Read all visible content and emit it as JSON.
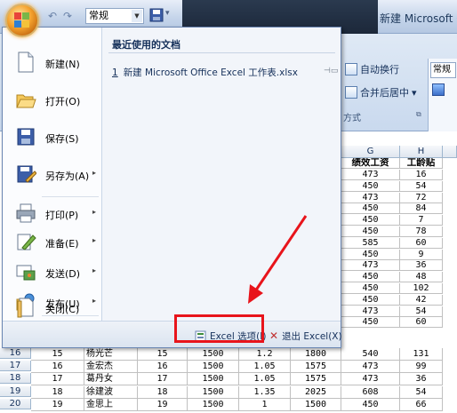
{
  "titlebar": {
    "style_combo": "常规",
    "app_title": "新建 Microsoft Of"
  },
  "ribbon": {
    "wrap_text": "自动换行",
    "merge_center": "合并后居中",
    "merge_arrow": "▾",
    "format_label": "常规",
    "group_alignment": "方式"
  },
  "columns": [
    {
      "letter": "G"
    },
    {
      "letter": "H"
    }
  ],
  "menu": {
    "items": [
      {
        "label": "新建(N)",
        "has_arrow": false
      },
      {
        "label": "打开(O)",
        "has_arrow": false
      },
      {
        "label": "保存(S)",
        "has_arrow": false
      },
      {
        "label": "另存为(A)",
        "has_arrow": true
      },
      {
        "label": "打印(P)",
        "has_arrow": true
      },
      {
        "label": "准备(E)",
        "has_arrow": true
      },
      {
        "label": "发送(D)",
        "has_arrow": true
      },
      {
        "label": "发布(U)",
        "has_arrow": true
      },
      {
        "label": "关闭(C)",
        "has_arrow": false
      }
    ],
    "arrow_glyph": "▸",
    "recent_header": "最近使用的文档",
    "recent_items": [
      {
        "number": "1",
        "name": "新建 Microsoft Office Excel 工作表.xlsx"
      }
    ],
    "excel_options": "Excel 选项(I)",
    "exit_excel": "退出 Excel(X)"
  },
  "visible_columns_right": {
    "header_G": "绩效工资",
    "header_H": "工龄贴",
    "rows": [
      [
        "473",
        "16"
      ],
      [
        "450",
        "54"
      ],
      [
        "473",
        "72"
      ],
      [
        "450",
        "84"
      ],
      [
        "450",
        "7"
      ],
      [
        "450",
        "78"
      ],
      [
        "585",
        "60"
      ],
      [
        "450",
        "9"
      ],
      [
        "473",
        "36"
      ],
      [
        "450",
        "48"
      ],
      [
        "450",
        "102"
      ],
      [
        "450",
        "42"
      ],
      [
        "473",
        "54"
      ],
      [
        "450",
        "60"
      ]
    ]
  },
  "sheet_rows": [
    {
      "row": "16",
      "cells": [
        "15",
        "杨光芒",
        "15",
        "1500",
        "1.2",
        "1800",
        "540",
        "131"
      ]
    },
    {
      "row": "17",
      "cells": [
        "16",
        "金宏杰",
        "16",
        "1500",
        "1.05",
        "1575",
        "473",
        "99"
      ]
    },
    {
      "row": "18",
      "cells": [
        "17",
        "葛丹女",
        "17",
        "1500",
        "1.05",
        "1575",
        "473",
        "36"
      ]
    },
    {
      "row": "19",
      "cells": [
        "18",
        "徐建波",
        "18",
        "1500",
        "1.35",
        "2025",
        "608",
        "54"
      ]
    },
    {
      "row": "20",
      "cells": [
        "19",
        "金思上",
        "19",
        "1500",
        "1",
        "1500",
        "450",
        "66"
      ]
    }
  ],
  "colors": {
    "annotation_red": "#e8141b",
    "office_orange": "#f4a22e"
  }
}
